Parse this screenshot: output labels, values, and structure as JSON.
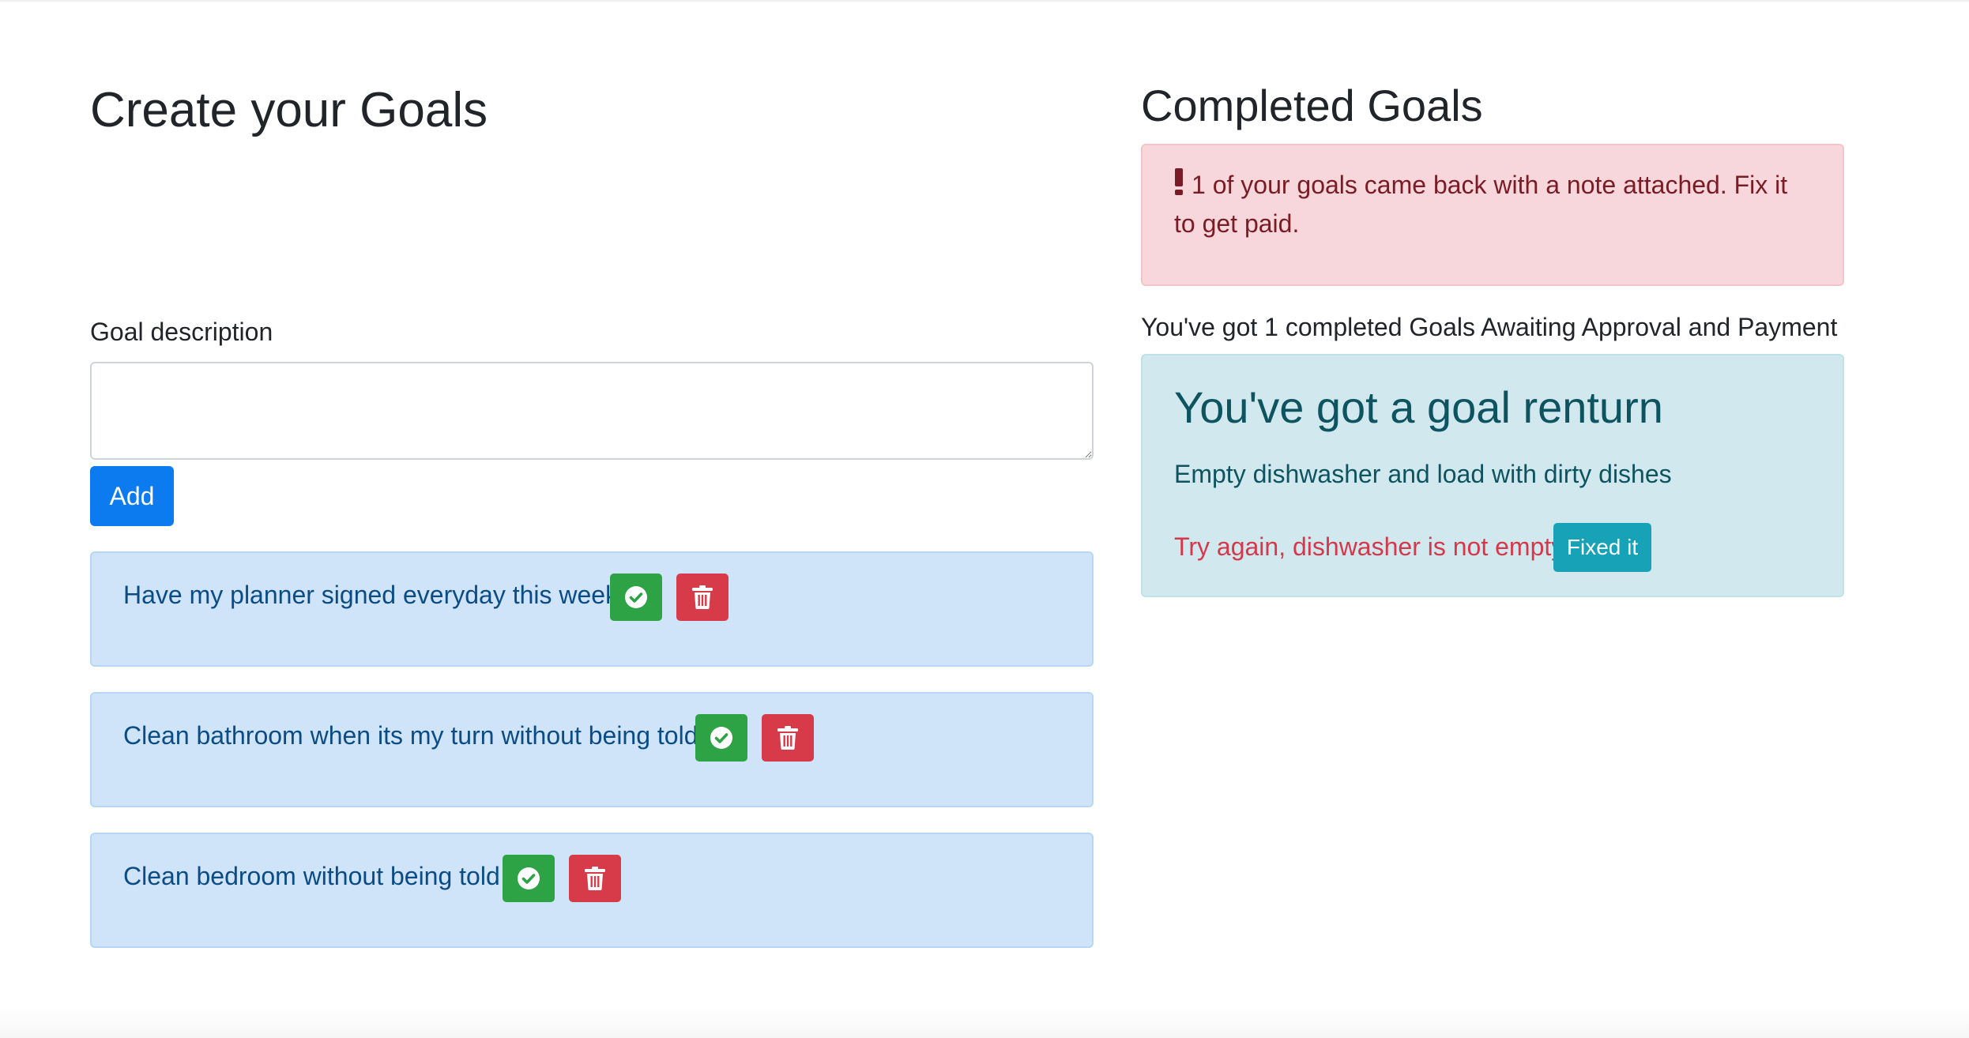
{
  "create": {
    "title": "Create your Goals",
    "field_label": "Goal description",
    "textarea_value": "",
    "add_label": "Add"
  },
  "goals": [
    {
      "text": "Have my planner signed everyday this week"
    },
    {
      "text": "Clean bathroom when its my turn without being told"
    },
    {
      "text": "Clean bedroom without being told"
    }
  ],
  "completed": {
    "title": "Completed Goals",
    "alert_text": "1 of your goals came back with a note attached. Fix it to get paid.",
    "awaiting_text": "You've got 1 completed Goals Awaiting Approval and Payment",
    "return_card": {
      "title": "You've got a goal renturn",
      "description": "Empty dishwasher and load with dirty dishes",
      "note": "Try again, dishwasher is not empty",
      "fix_label": "Fixed it"
    }
  },
  "icons": {
    "complete": "check-circle-icon",
    "delete": "trash-icon",
    "alert": "exclamation-icon"
  },
  "colors": {
    "primary": "#0d7bf0",
    "success": "#2ea345",
    "danger": "#d73a48",
    "info": "#17a2b8",
    "goal_card_bg": "#cfe3f9",
    "alert_bg": "#f8d7dc",
    "return_card_bg": "#d1e9ee"
  }
}
